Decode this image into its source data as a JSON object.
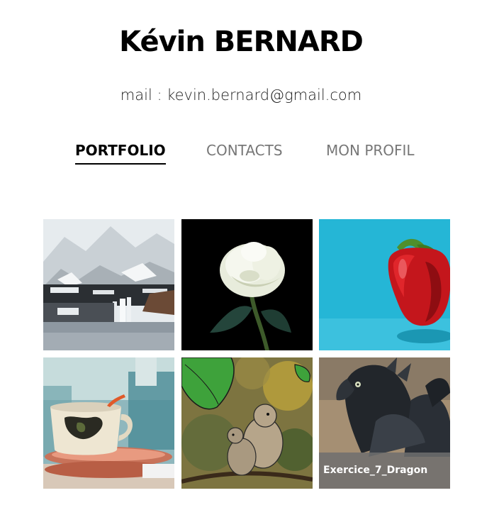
{
  "header": {
    "name": "Kévin BERNARD",
    "mail": "mail : kevin.bernard@gmail.com"
  },
  "nav": {
    "items": [
      {
        "label": "PORTFOLIO",
        "active": true
      },
      {
        "label": "CONTACTS",
        "active": false
      },
      {
        "label": "MON PROFIL",
        "active": false
      }
    ]
  },
  "gallery": {
    "tiles": [
      {
        "subject": "landscape-waterfall"
      },
      {
        "subject": "white-rose"
      },
      {
        "subject": "red-pepper"
      },
      {
        "subject": "coffee-cup"
      },
      {
        "subject": "birds-on-branch"
      },
      {
        "subject": "dragon",
        "caption": "Exercice_7_Dragon"
      }
    ]
  }
}
